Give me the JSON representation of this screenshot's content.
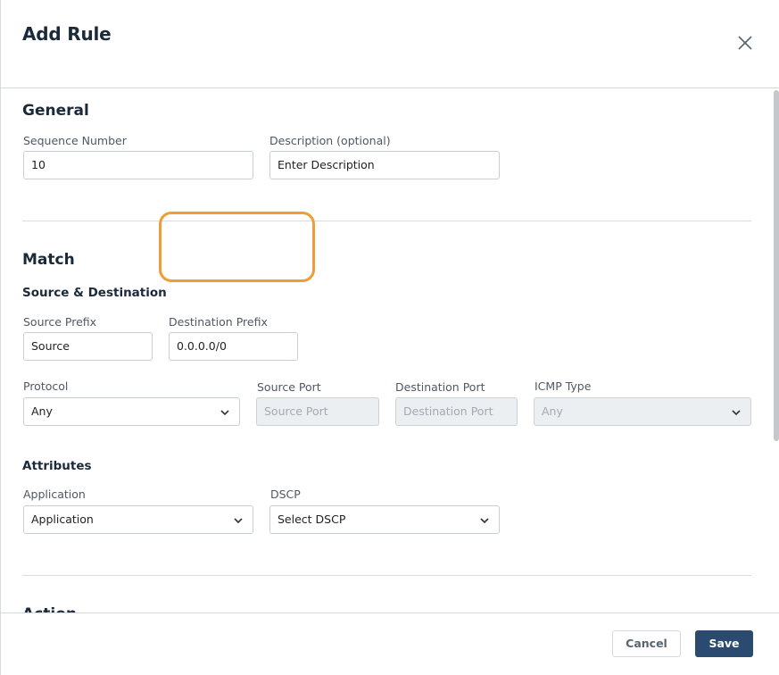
{
  "dialog": {
    "title": "Add Rule",
    "close_icon": "close-icon"
  },
  "general": {
    "heading": "General",
    "sequence_label": "Sequence Number",
    "sequence_value": "10",
    "description_label": "Description (optional)",
    "description_placeholder": "Enter Description"
  },
  "match": {
    "heading": "Match",
    "src_dst_heading": "Source & Destination",
    "source_prefix_label": "Source Prefix",
    "source_prefix_placeholder": "Source",
    "destination_prefix_label": "Destination Prefix",
    "destination_prefix_value": "0.0.0.0/0",
    "protocol_label": "Protocol",
    "protocol_value": "Any",
    "source_port_label": "Source Port",
    "source_port_placeholder": "Source Port",
    "destination_port_label": "Destination Port",
    "destination_port_placeholder": "Destination Port",
    "icmp_type_label": "ICMP Type",
    "icmp_type_value": "Any"
  },
  "attributes": {
    "heading": "Attributes",
    "application_label": "Application",
    "application_value": "Application",
    "dscp_label": "DSCP",
    "dscp_value": "Select DSCP"
  },
  "action": {
    "heading": "Action"
  },
  "footer": {
    "cancel_label": "Cancel",
    "save_label": "Save"
  },
  "colors": {
    "highlight": "#ef9d36",
    "primary_button": "#2a4a6f"
  }
}
